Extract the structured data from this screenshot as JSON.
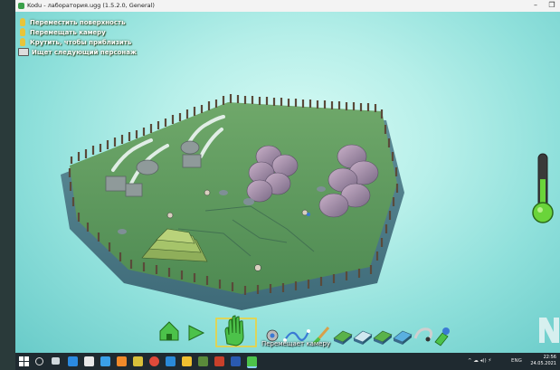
{
  "window": {
    "title": "Kodu - лаборатория.ugg (1.5.2.0, General)",
    "minimize": "–",
    "maximize": "❐"
  },
  "hints": [
    {
      "icon": "hand-icon",
      "text": "Переместить поверхность"
    },
    {
      "icon": "hand-icon",
      "text": "Перемещать камеру"
    },
    {
      "icon": "hand-icon",
      "text": "Крутить, чтобы приблизить"
    },
    {
      "icon": "keyboard-icon",
      "text": "Ищет следующий персонаж"
    }
  ],
  "toolbar": {
    "tools": [
      {
        "name": "home",
        "icon": "home-icon"
      },
      {
        "name": "play",
        "icon": "play-icon"
      },
      {
        "name": "move-camera",
        "icon": "hand-icon",
        "selected": true
      },
      {
        "name": "object",
        "icon": "object-icon"
      },
      {
        "name": "path",
        "icon": "path-icon"
      },
      {
        "name": "paint",
        "icon": "brush-icon"
      },
      {
        "name": "raise-terrain",
        "icon": "terrain-raise-icon"
      },
      {
        "name": "smooth-terrain",
        "icon": "terrain-smooth-icon"
      },
      {
        "name": "roughen-terrain",
        "icon": "terrain-rough-icon"
      },
      {
        "name": "water",
        "icon": "water-icon"
      },
      {
        "name": "delete",
        "icon": "eraser-icon"
      },
      {
        "name": "world-settings",
        "icon": "settings-icon"
      }
    ],
    "status": "Перемещает камеру"
  },
  "gauge": {
    "fill": 0.55,
    "color": "#6ad43a"
  },
  "taskbar": {
    "language": "ENG",
    "time": "22:56",
    "date": "24.05.2021"
  }
}
